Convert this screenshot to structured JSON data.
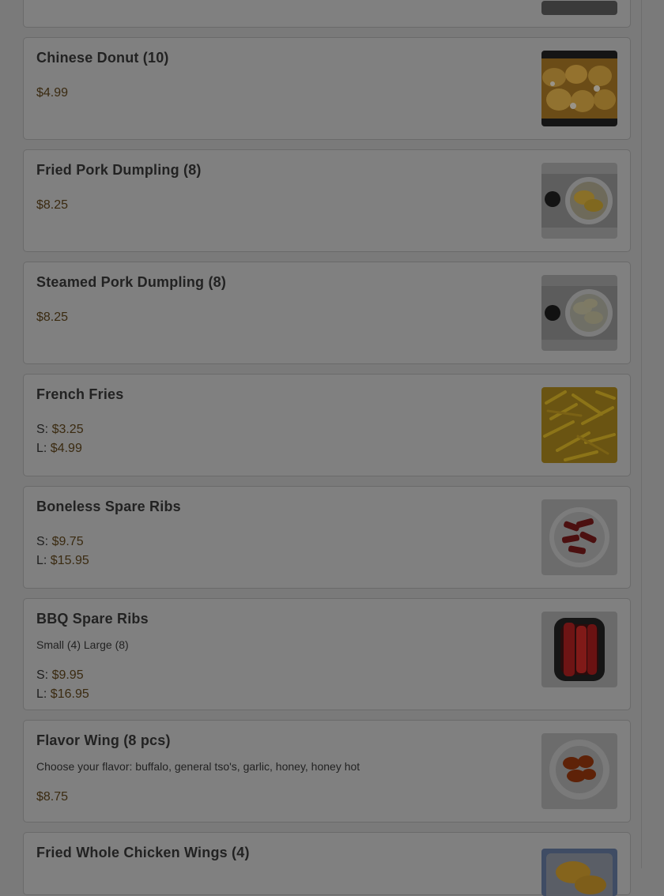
{
  "items": [
    {
      "name": "",
      "description": "",
      "prices": [],
      "image_icon": "food-photo-icon"
    },
    {
      "name": "Chinese Donut (10)",
      "description": "",
      "prices": [
        {
          "prefix": "",
          "value": "$4.99"
        }
      ],
      "image_icon": "chinese-donut-photo-icon"
    },
    {
      "name": "Fried Pork Dumpling (8)",
      "description": "",
      "prices": [
        {
          "prefix": "",
          "value": "$8.25"
        }
      ],
      "image_icon": "fried-dumpling-photo-icon"
    },
    {
      "name": "Steamed Pork Dumpling (8)",
      "description": "",
      "prices": [
        {
          "prefix": "",
          "value": "$8.25"
        }
      ],
      "image_icon": "steamed-dumpling-photo-icon"
    },
    {
      "name": "French Fries",
      "description": "",
      "prices": [
        {
          "prefix": "S: ",
          "value": "$3.25"
        },
        {
          "prefix": "L: ",
          "value": "$4.99"
        }
      ],
      "image_icon": "french-fries-photo-icon"
    },
    {
      "name": "Boneless Spare Ribs",
      "description": "",
      "prices": [
        {
          "prefix": "S: ",
          "value": "$9.75"
        },
        {
          "prefix": "L: ",
          "value": "$15.95"
        }
      ],
      "image_icon": "boneless-ribs-photo-icon"
    },
    {
      "name": "BBQ Spare Ribs",
      "description": "Small (4) Large (8)",
      "prices": [
        {
          "prefix": "S: ",
          "value": "$9.95"
        },
        {
          "prefix": "L: ",
          "value": "$16.95"
        }
      ],
      "image_icon": "bbq-ribs-photo-icon"
    },
    {
      "name": "Flavor Wing (8 pcs)",
      "description": "Choose your flavor: buffalo, general tso's, garlic, honey, honey hot",
      "prices": [
        {
          "prefix": "",
          "value": "$8.75"
        }
      ],
      "image_icon": "chicken-wings-photo-icon"
    },
    {
      "name": "Fried Whole Chicken Wings (4)",
      "description": "",
      "prices": [],
      "image_icon": "fried-wings-photo-icon"
    }
  ],
  "colors": {
    "overlay": "#7a7a7a",
    "card": "#808080",
    "price": "#3a2a10"
  }
}
